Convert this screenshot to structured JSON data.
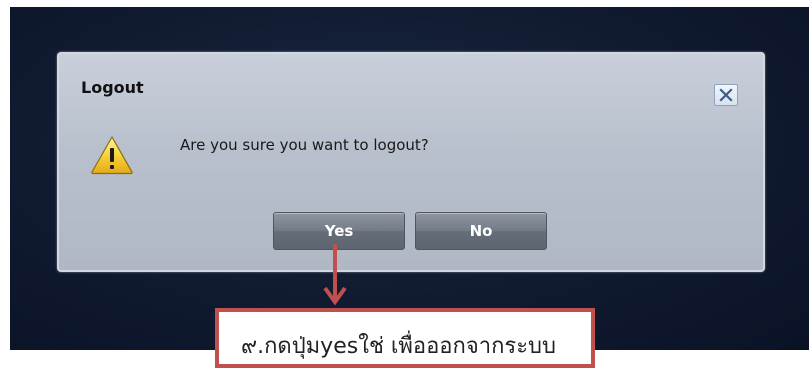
{
  "dialog": {
    "title": "Logout",
    "close_icon": "close-icon",
    "warning_icon": "warning-icon",
    "message": "Are you sure you want to logout?",
    "buttons": {
      "yes_label": "Yes",
      "no_label": "No"
    }
  },
  "annotation": {
    "text": "๙.กดปุ่มyesใช่ เพื่อออกจากระบบ"
  },
  "colors": {
    "backdrop": "#101a30",
    "dialog_bg": "#b8c0cd",
    "button_bg": "#747c88",
    "annotation_border": "#c0504d",
    "arrow": "#c0504d",
    "warning_yellow": "#f7d23a"
  }
}
